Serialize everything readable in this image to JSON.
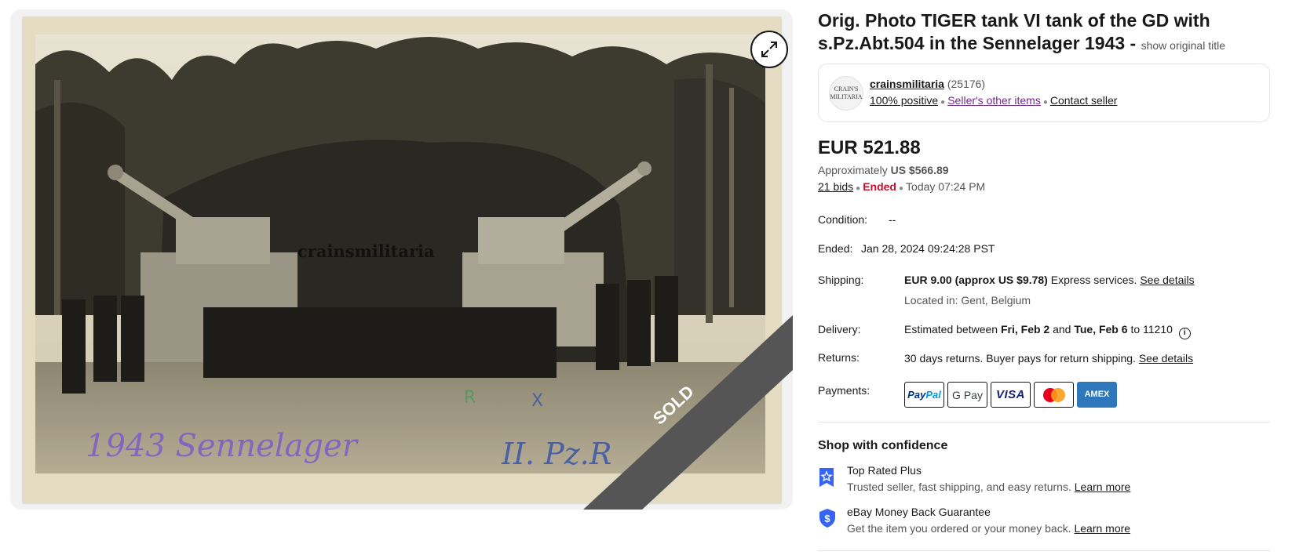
{
  "listing": {
    "title": "Orig. Photo TIGER tank VI tank of the GD with s.Pz.Abt.504 in the Sennelager 1943 -",
    "show_original_title": "show original title",
    "sold_badge": "SOLD",
    "photo_watermark": "crainsmilitaria",
    "photo_caption_left": "1943 Sennelager",
    "photo_caption_right": "II. Pz.R"
  },
  "seller": {
    "logo_line1": "CRAIN'S",
    "logo_line2": "MILITARIA",
    "name": "crainsmilitaria",
    "feedback_count": "(25176)",
    "positive": "100% positive",
    "other_items": "Seller's other items",
    "contact": "Contact seller"
  },
  "pricing": {
    "price": "EUR 521.88",
    "approx_label": "Approximately",
    "approx_value": "US $566.89",
    "bids": "21 bids",
    "status": "Ended",
    "ended_time": "Today 07:24 PM"
  },
  "details": {
    "condition_label": "Condition:",
    "condition_value": "--",
    "ended_label": "Ended:",
    "ended_value": "Jan 28, 2024 09:24:28 PST",
    "shipping_label": "Shipping:",
    "shipping_price": "EUR 9.00 (approx US $9.78)",
    "shipping_service": "Express services.",
    "shipping_link": "See details",
    "location": "Located in: Gent, Belgium",
    "delivery_label": "Delivery:",
    "delivery_prefix": "Estimated between",
    "delivery_start": "Fri, Feb 2",
    "delivery_and": "and",
    "delivery_end": "Tue, Feb 6",
    "delivery_suffix": "to 11210",
    "returns_label": "Returns:",
    "returns_text": "30 days returns. Buyer pays for return shipping.",
    "returns_link": "See details",
    "payments_label": "Payments:",
    "payment_methods": [
      "PayPal",
      "G Pay",
      "VISA",
      "Mastercard",
      "AMEX"
    ]
  },
  "confidence": {
    "title": "Shop with confidence",
    "items": [
      {
        "title": "Top Rated Plus",
        "desc": "Trusted seller, fast shipping, and easy returns.",
        "link": "Learn more",
        "icon": "badge-star-icon"
      },
      {
        "title": "eBay Money Back Guarantee",
        "desc": "Get the item you ordered or your money back.",
        "link": "Learn more",
        "icon": "shield-dollar-icon"
      }
    ]
  },
  "colors": {
    "ended": "#c4112f",
    "link_visited": "#6f2a8c",
    "ribbon": "#555555",
    "icon_blue": "#3665f3"
  }
}
